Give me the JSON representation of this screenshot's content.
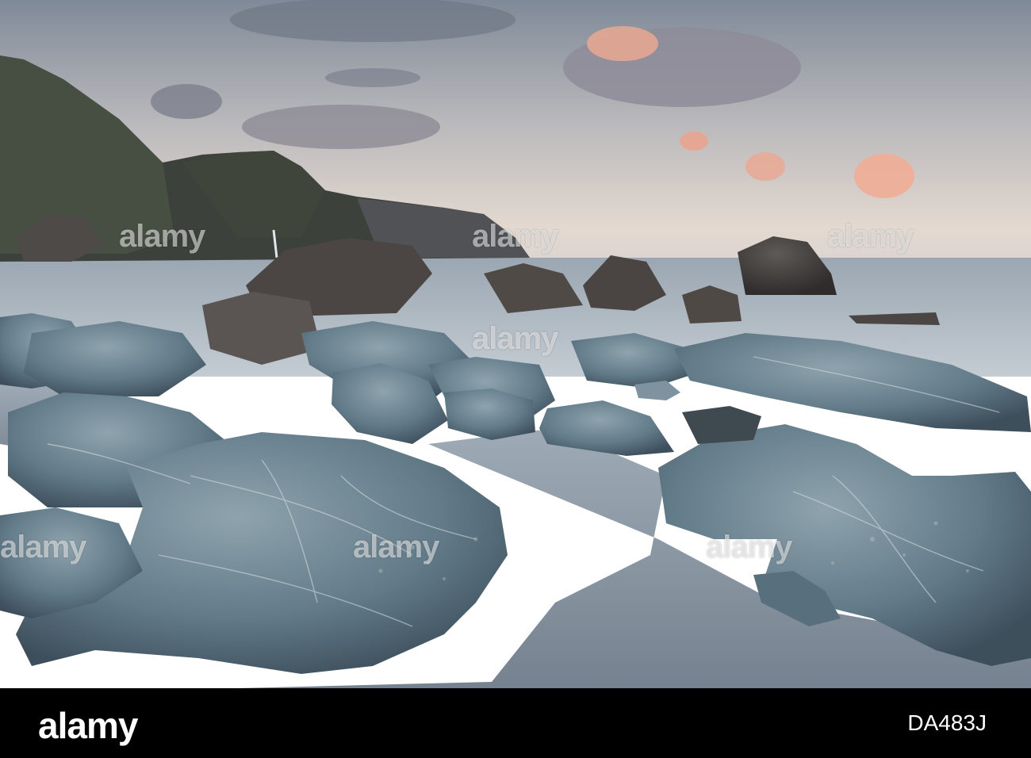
{
  "watermark": {
    "text": "alamy"
  },
  "footer": {
    "brand": "alamy",
    "image_code": "DA483J"
  },
  "colors": {
    "sky_top": "#8a95a3",
    "sky_horizon": "#e6d9cf",
    "cloud_pink": "#e8a694",
    "sea": "#a5b2bd",
    "rock_blue": "#6f8795",
    "cliff": "#3b3f3a",
    "bar": "#000000"
  }
}
